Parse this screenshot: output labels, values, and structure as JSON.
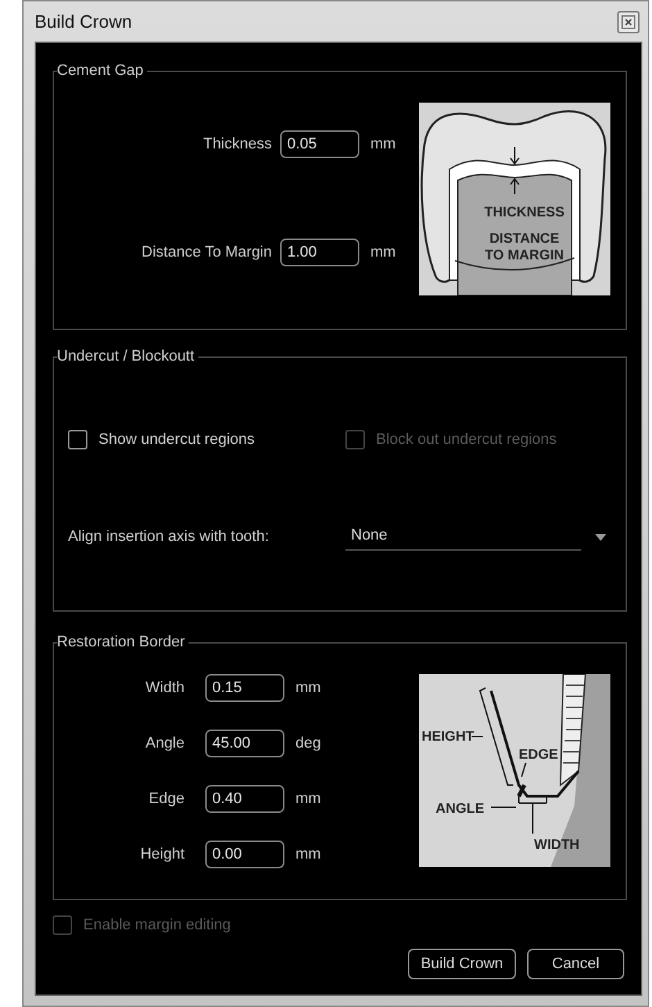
{
  "window": {
    "title": "Build Crown"
  },
  "cement_gap": {
    "title": "Cement Gap",
    "fields": [
      {
        "label": "Thickness",
        "value": "0.05",
        "unit": "mm"
      },
      {
        "label": "Distance To Margin",
        "value": "1.00",
        "unit": "mm"
      }
    ],
    "diagram_labels": [
      "THICKNESS",
      "DISTANCE",
      "TO MARGIN"
    ]
  },
  "undercut": {
    "title": "Undercut / Blockoutt",
    "checkboxes": [
      {
        "label": "Show undercut regions",
        "checked": false,
        "disabled": false
      },
      {
        "label": "Block out undercut regions",
        "checked": false,
        "disabled": true
      }
    ],
    "align": {
      "label": "Align insertion axis with tooth:",
      "value": "None"
    }
  },
  "restoration_border": {
    "title": "Restoration Border",
    "fields": [
      {
        "label": "Width",
        "value": "0.15",
        "unit": "mm"
      },
      {
        "label": "Angle",
        "value": "45.00",
        "unit": "deg"
      },
      {
        "label": "Edge",
        "value": "0.40",
        "unit": "mm"
      },
      {
        "label": "Height",
        "value": "0.00",
        "unit": "mm"
      }
    ],
    "diagram_labels": [
      "HEIGHT",
      "EDGE",
      "ANGLE",
      "WIDTH"
    ]
  },
  "margin_editing": {
    "label": "Enable margin editing",
    "checked": false,
    "disabled": true
  },
  "buttons": [
    "Build Crown",
    "Cancel"
  ]
}
